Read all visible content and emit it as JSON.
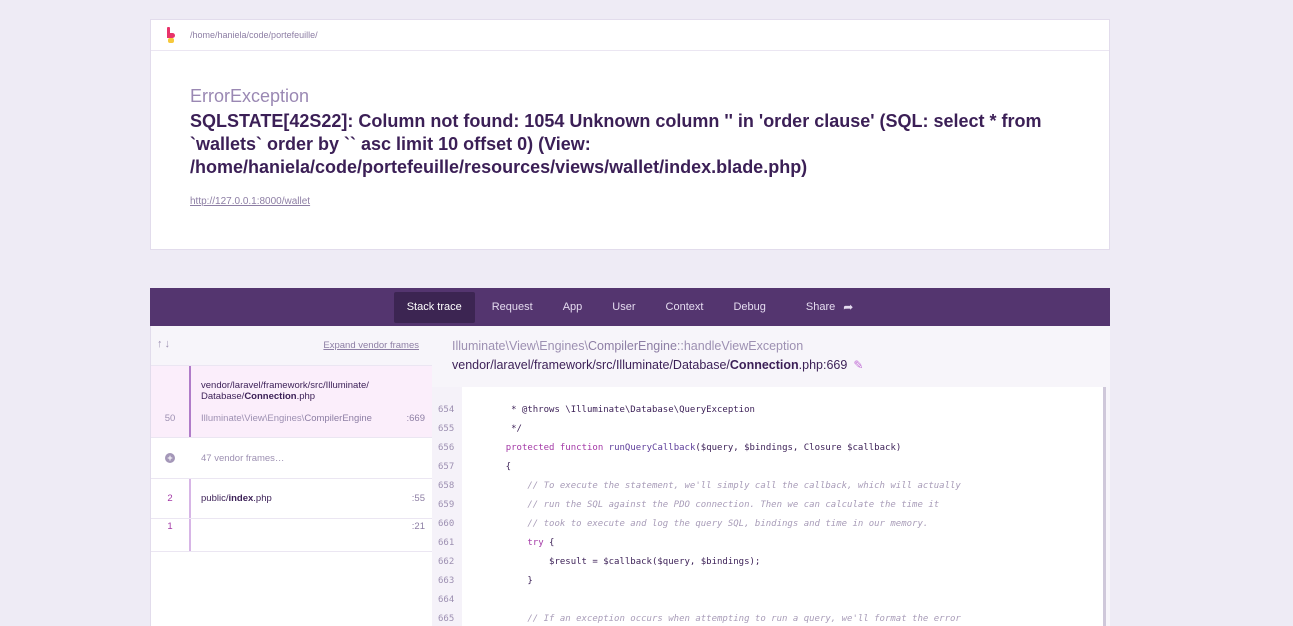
{
  "header": {
    "path": "/home/haniela/code/portefeuille/",
    "exception_class": "ErrorException",
    "message": "SQLSTATE[42S22]: Column not found: 1054 Unknown column '' in 'order clause' (SQL: select * from `wallets` order by `` asc limit 10 offset 0) (View: /home/haniela/code/portefeuille/resources/views/wallet/index.blade.php)",
    "url": "http://127.0.0.1:8000/wallet"
  },
  "tabs": [
    "Stack trace",
    "Request",
    "App",
    "User",
    "Context",
    "Debug",
    "Share"
  ],
  "frames_panel": {
    "expand_label": "Expand vendor frames",
    "frames": [
      {
        "number": "50",
        "path_prefix": "vendor/laravel/framework/src/Illuminate/",
        "path_mid": "Database/",
        "path_file": "Connection",
        "path_ext": ".php",
        "class_prefix": "Illuminate\\View\\Engines\\",
        "class_name": "CompilerEngine",
        "line": ":669"
      },
      {
        "vendor_label": "47 vendor frames…"
      },
      {
        "number": "2",
        "path_prefix": "public/",
        "path_file": "index",
        "path_ext": ".php",
        "line": ":55"
      },
      {
        "number": "1",
        "line": ":21"
      }
    ]
  },
  "code_panel": {
    "class_prefix": "Illuminate\\View\\Engines\\",
    "class_name": "CompilerEngine",
    "method": "::handleViewException",
    "file_prefix": "vendor/laravel/framework/src/Illuminate/Database/",
    "file_name": "Connection",
    "file_suffix": ".php:669",
    "lines": [
      {
        "n": "654",
        "text": "     * @throws \\Illuminate\\Database\\QueryException"
      },
      {
        "n": "655",
        "text": "     */"
      },
      {
        "n": "656",
        "text": "    protected function runQueryCallback($query, $bindings, Closure $callback)"
      },
      {
        "n": "657",
        "text": "    {"
      },
      {
        "n": "658",
        "text": "        // To execute the statement, we'll simply call the callback, which will actually"
      },
      {
        "n": "659",
        "text": "        // run the SQL against the PDO connection. Then we can calculate the time it"
      },
      {
        "n": "660",
        "text": "        // took to execute and log the query SQL, bindings and time in our memory."
      },
      {
        "n": "661",
        "text": "        try {"
      },
      {
        "n": "662",
        "text": "            $result = $callback($query, $bindings);"
      },
      {
        "n": "663",
        "text": "        }"
      },
      {
        "n": "664",
        "text": ""
      },
      {
        "n": "665",
        "text": "        // If an exception occurs when attempting to run a query, we'll format the error"
      }
    ]
  },
  "colors": {
    "accent": "#54356f",
    "active_tab": "#3c2552",
    "selected_frame": "#fbeefb",
    "keyword": "#a338a6"
  }
}
